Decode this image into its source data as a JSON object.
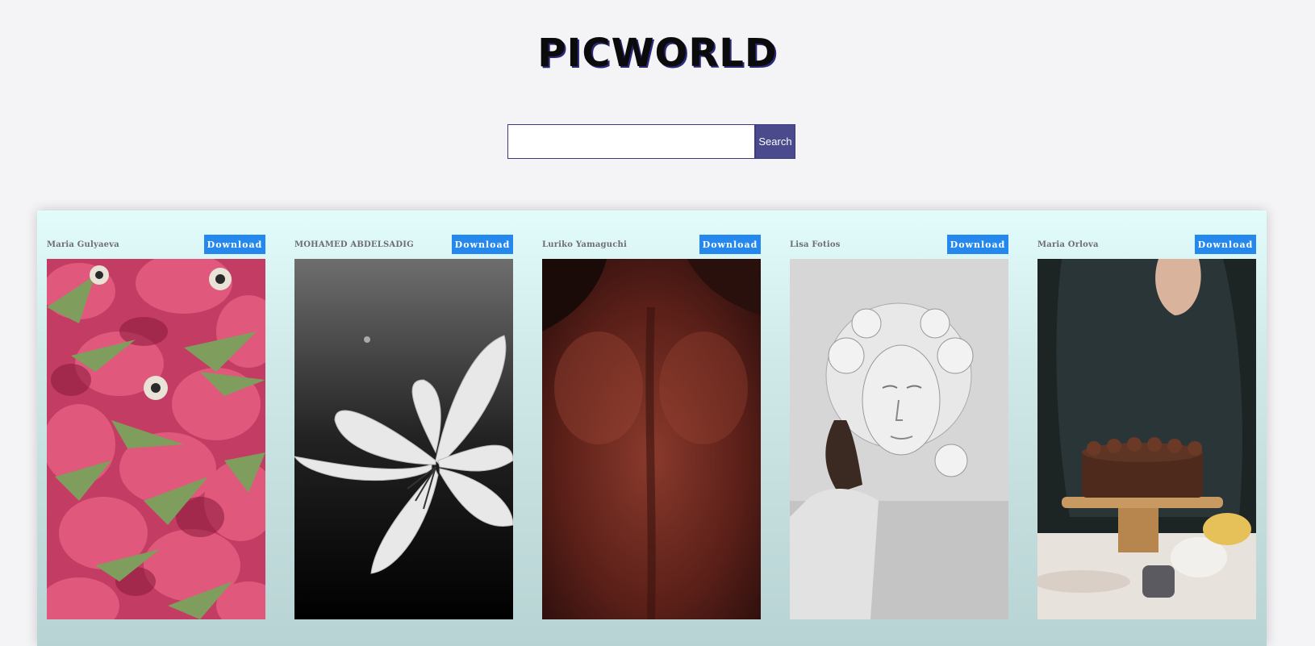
{
  "header": {
    "title": "PICWORLD"
  },
  "search": {
    "value": "",
    "placeholder": "",
    "button_label": "Search"
  },
  "colors": {
    "accent": "#4a4a8c",
    "download": "#2488ee",
    "background": "#f4f3f5"
  },
  "gallery": {
    "cards": [
      {
        "photographer": "Maria Gulyaeva",
        "download_label": "Download",
        "image": "pink-dragon-fruit-photo"
      },
      {
        "photographer": "MOHAMED ABDELSADIG",
        "download_label": "Download",
        "image": "white-flower-photo"
      },
      {
        "photographer": "Luriko Yamaguchi",
        "download_label": "Download",
        "image": "bare-back-photo"
      },
      {
        "photographer": "Lisa Fotios",
        "download_label": "Download",
        "image": "sculpture-face-photo"
      },
      {
        "photographer": "Maria Orlova",
        "download_label": "Download",
        "image": "chocolate-cake-photo"
      }
    ]
  }
}
